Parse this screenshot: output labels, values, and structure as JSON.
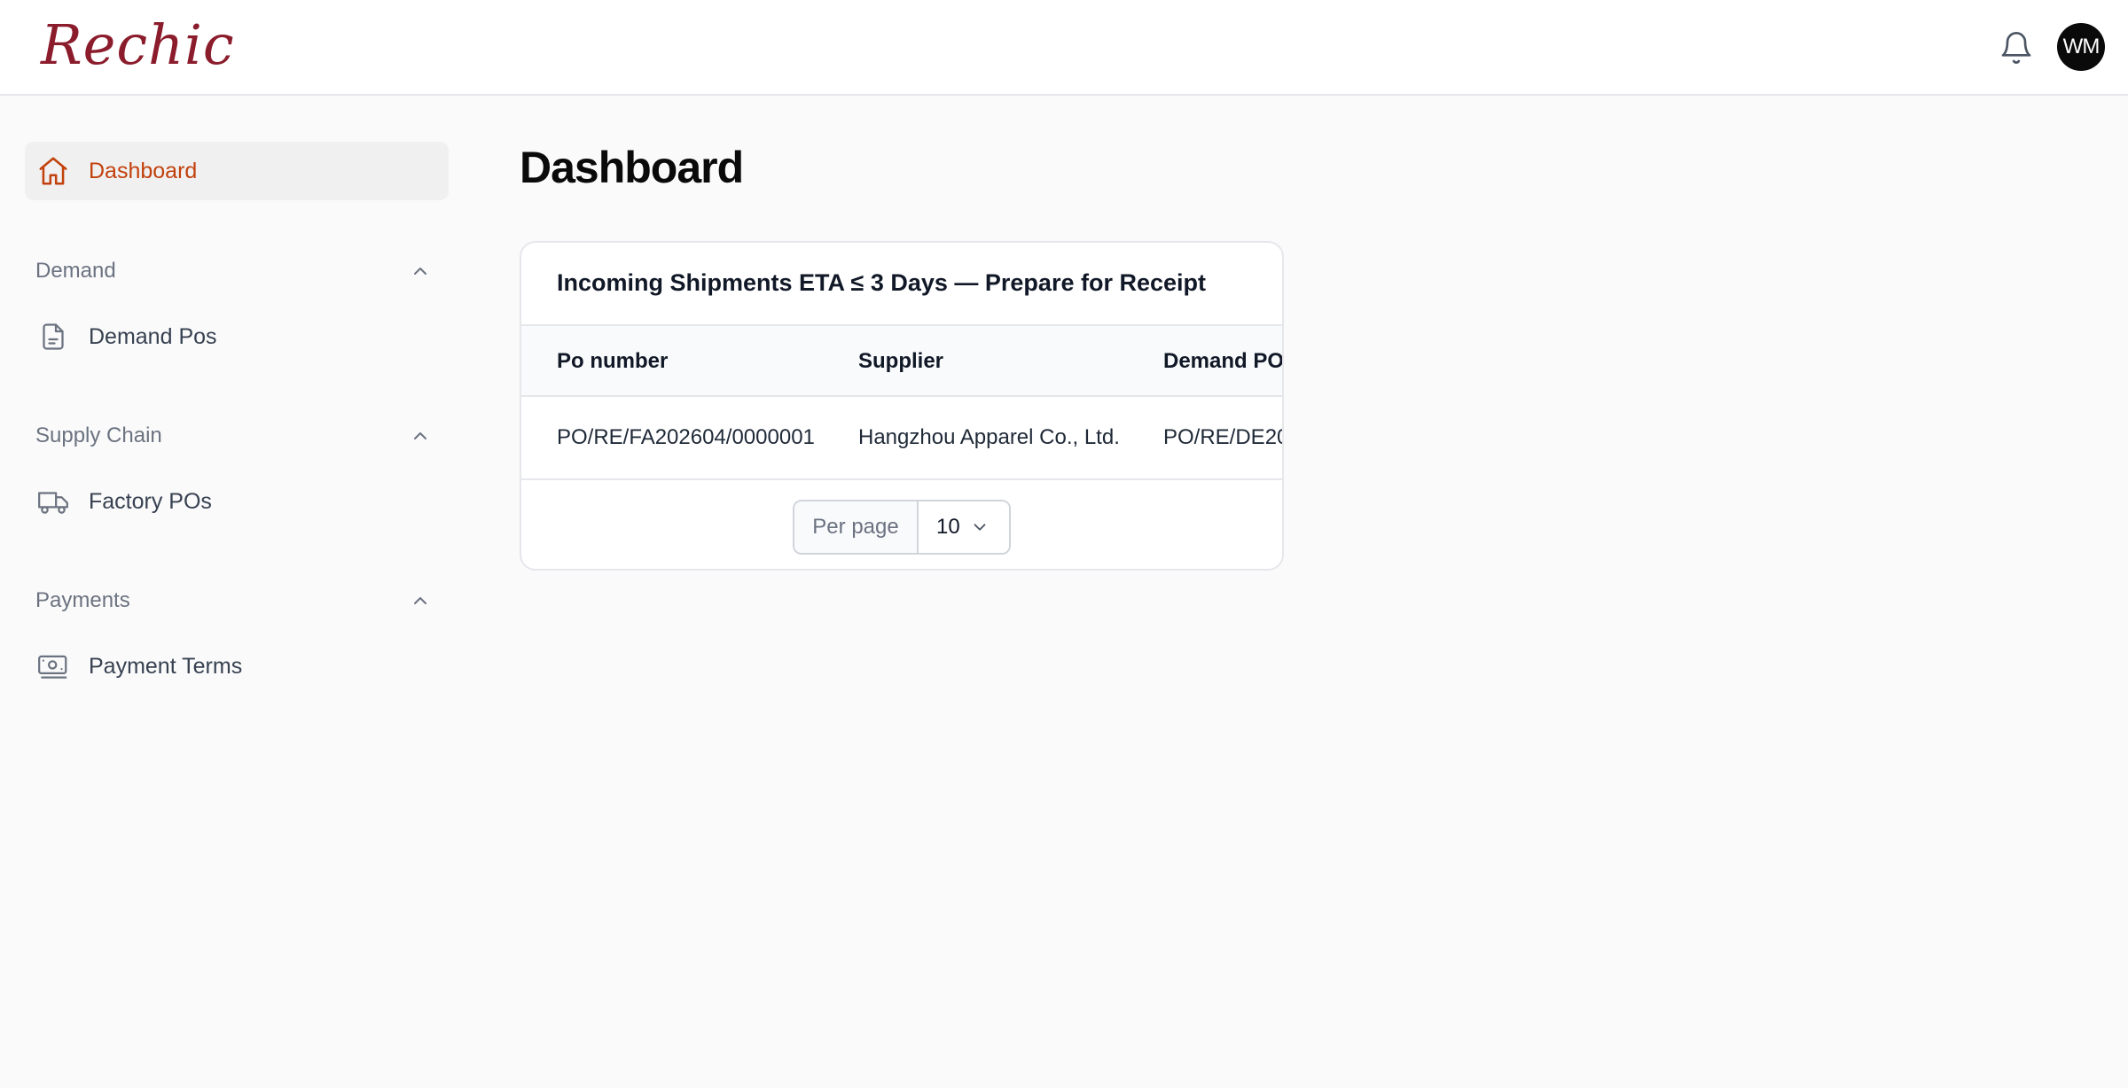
{
  "header": {
    "logo": "Rechic",
    "avatar_initials": "WM",
    "icons": {
      "notifications": "bell-icon"
    }
  },
  "sidebar": {
    "dashboard": {
      "label": "Dashboard",
      "icon": "home-icon"
    },
    "groups": [
      {
        "title": "Demand",
        "items": [
          {
            "label": "Demand Pos",
            "icon": "document-icon"
          }
        ]
      },
      {
        "title": "Supply Chain",
        "items": [
          {
            "label": "Factory POs",
            "icon": "truck-icon"
          }
        ]
      },
      {
        "title": "Payments",
        "items": [
          {
            "label": "Payment Terms",
            "icon": "banknote-icon"
          }
        ]
      }
    ]
  },
  "main": {
    "title": "Dashboard",
    "card": {
      "title": "Incoming Shipments ETA ≤ 3 Days — Prepare for Receipt",
      "columns": [
        "Po number",
        "Supplier",
        "Demand PO"
      ],
      "rows": [
        [
          "PO/RE/FA202604/0000001",
          "Hangzhou Apparel Co., Ltd.",
          "PO/RE/DE20"
        ]
      ],
      "pagination": {
        "per_page_label": "Per page",
        "per_page_value": "10"
      }
    }
  },
  "colors": {
    "brand": "#8b1c2c",
    "active_nav": "#c2410c",
    "avatar_bg": "#0a0a0a"
  }
}
